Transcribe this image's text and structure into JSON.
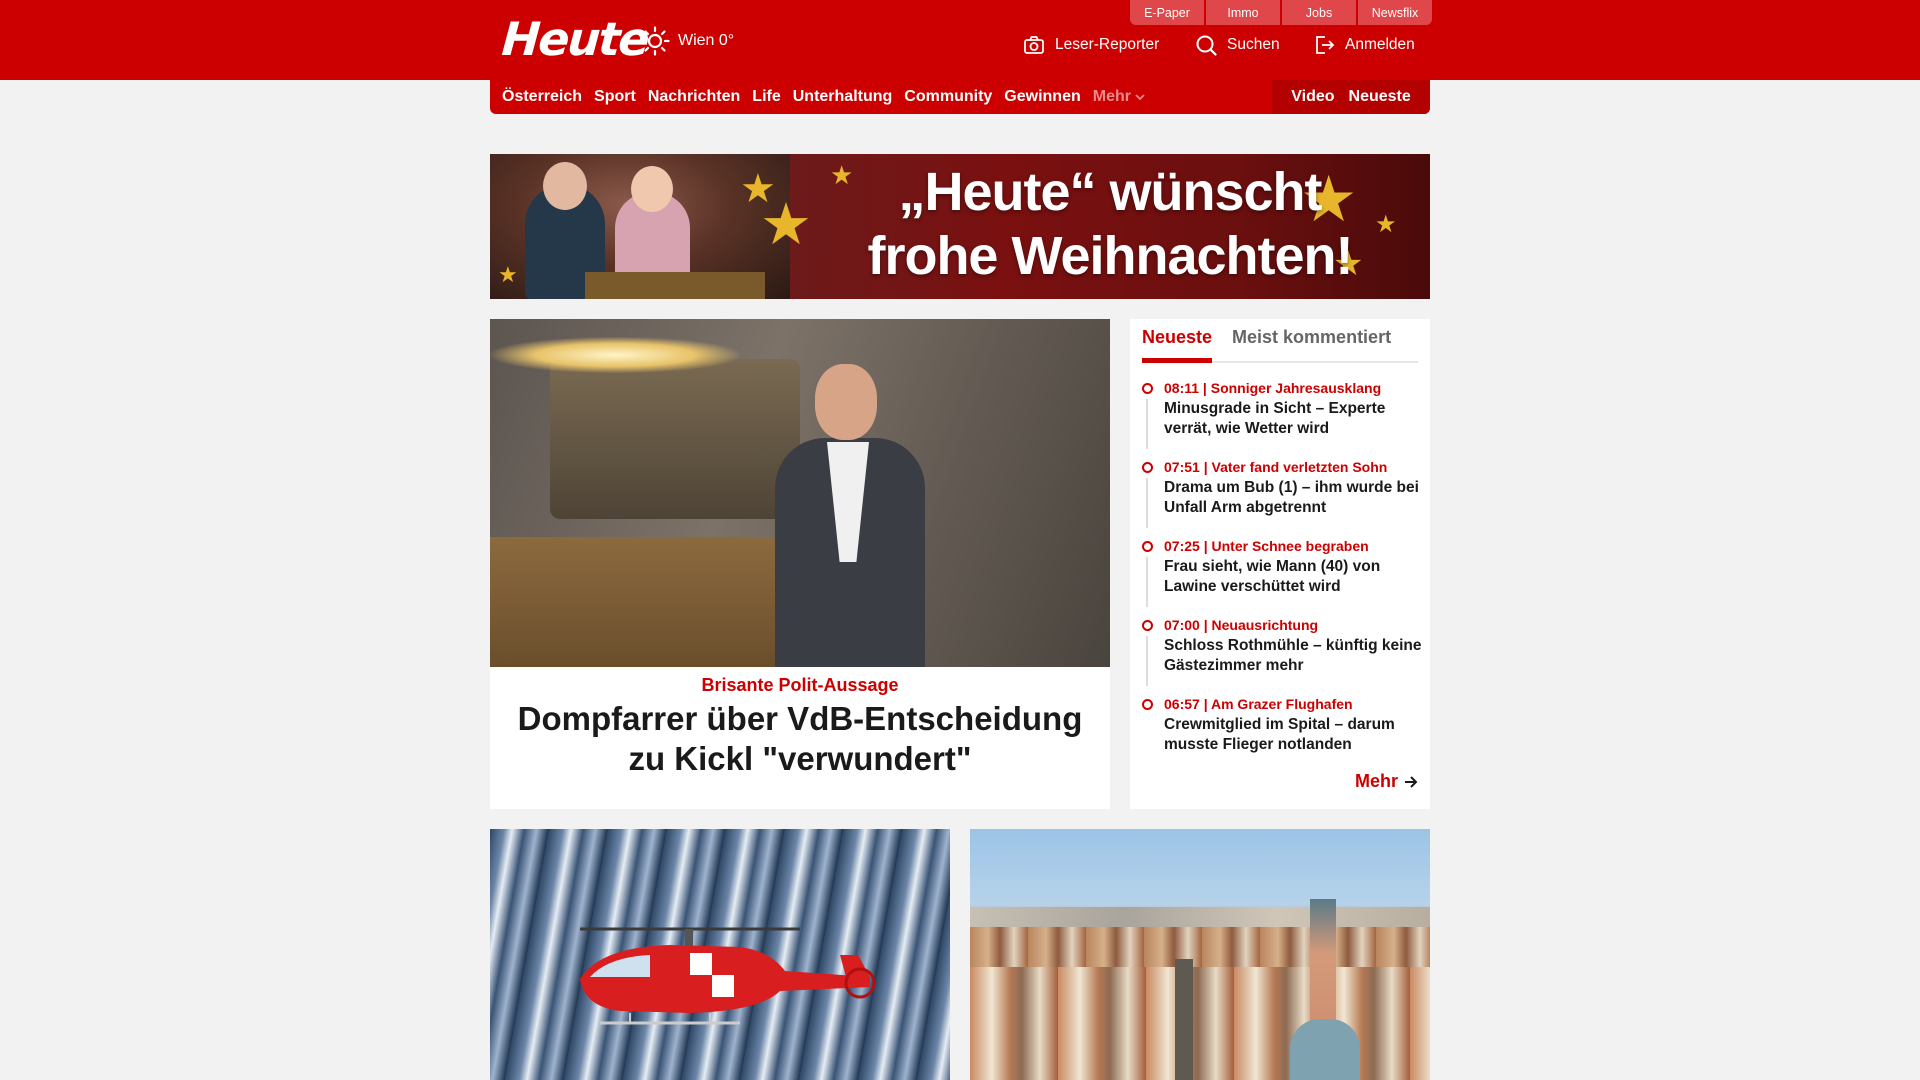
{
  "header": {
    "logo": "Heute",
    "weather": "Wien 0°",
    "top_links": [
      "E-Paper",
      "Immo",
      "Jobs",
      "Newsflix"
    ],
    "actions": {
      "reporter": "Leser-Reporter",
      "search": "Suchen",
      "login": "Anmelden"
    }
  },
  "nav": {
    "items": [
      "Österreich",
      "Sport",
      "Nachrichten",
      "Life",
      "Unterhaltung",
      "Community",
      "Gewinnen"
    ],
    "more": "Mehr",
    "video": "Video",
    "newest": "Neueste"
  },
  "banner": {
    "line1": "„Heute“ wünscht",
    "line2": "frohe Weihnachten!"
  },
  "hero": {
    "kicker": "Brisante Polit-Aussage",
    "title": "Dompfarrer über VdB-Entscheidung zu Kickl \"verwundert\""
  },
  "panel": {
    "tabs": [
      "Neueste",
      "Meist kommentiert"
    ],
    "items": [
      {
        "meta": "08:11 | Sonniger Jahresausklang",
        "title": "Minusgrade in Sicht – Experte verrät, wie Wetter wird"
      },
      {
        "meta": "07:51 | Vater fand verletzten Sohn",
        "title": "Drama um Bub (1)  – ihm wurde bei Unfall Arm abgetrennt"
      },
      {
        "meta": "07:25 | Unter Schnee begraben",
        "title": "Frau sieht, wie Mann (40) von Lawine verschüttet wird"
      },
      {
        "meta": "07:00 | Neuausrichtung",
        "title": "Schloss Rothmühle – künftig keine Gästezimmer mehr"
      },
      {
        "meta": "06:57 | Am Grazer Flughafen",
        "title": "Crewmitglied im Spital – darum musste Flieger notlanden"
      }
    ],
    "more": "Mehr"
  },
  "colors": {
    "brand": "#cc0000",
    "brand_dark": "#b30000",
    "page_bg": "#f2f2f2"
  }
}
